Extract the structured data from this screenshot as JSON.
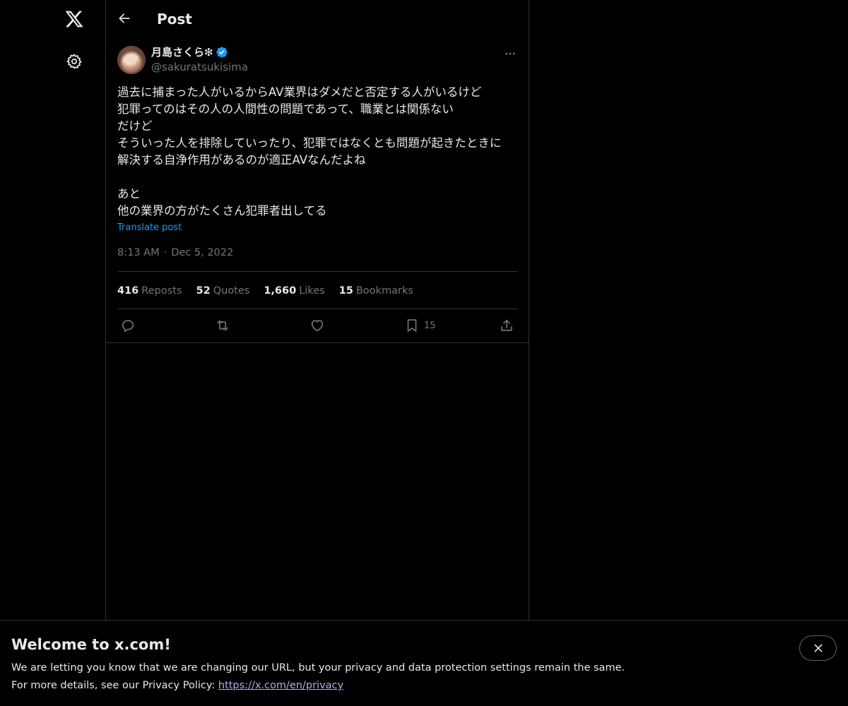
{
  "nav": {
    "logo_icon": "x-logo-icon",
    "settings_icon": "gear-icon"
  },
  "header": {
    "back_icon": "arrow-left-icon",
    "title": "Post"
  },
  "post": {
    "author": {
      "name": "月島さくら❇︎",
      "handle": "@sakuratsukisima",
      "verified": true,
      "verified_color": "#1d9bf0"
    },
    "text_lines": [
      "過去に捕まった人がいるからAV業界はダメだと否定する人がいるけど",
      "犯罪ってのはその人の人間性の問題であって、職業とは関係ない",
      "だけど",
      "そういった人を排除していったり、犯罪ではなくとも問題が起きたときに",
      "解決する自浄作用があるのが適正AVなんだよね",
      "",
      "あと",
      "他の業界の方がたくさん犯罪者出してる"
    ],
    "translate_label": "Translate post",
    "time": "8:13 AM",
    "date": "Dec 5, 2022",
    "separator": "·",
    "stats": {
      "reposts": {
        "count": "416",
        "label": "Reposts"
      },
      "quotes": {
        "count": "52",
        "label": "Quotes"
      },
      "likes": {
        "count": "1,660",
        "label": "Likes"
      },
      "bookmarks": {
        "count": "15",
        "label": "Bookmarks"
      }
    },
    "actions": {
      "reply_icon": "reply-icon",
      "repost_icon": "repost-icon",
      "like_icon": "heart-icon",
      "bookmark_icon": "bookmark-icon",
      "bookmark_count": "15",
      "share_icon": "share-icon"
    }
  },
  "banner": {
    "title": "Welcome to x.com!",
    "line1": "We are letting you know that we are changing our URL, but your privacy and data protection settings remain the same.",
    "line2_prefix": "For more details, see our Privacy Policy: ",
    "link_text": "https://x.com/en/privacy",
    "close_icon": "close-icon"
  },
  "colors": {
    "background": "#000000",
    "text": "#e7e9ea",
    "muted": "#71767b",
    "accent": "#1d9bf0",
    "border": "#2f3336"
  }
}
